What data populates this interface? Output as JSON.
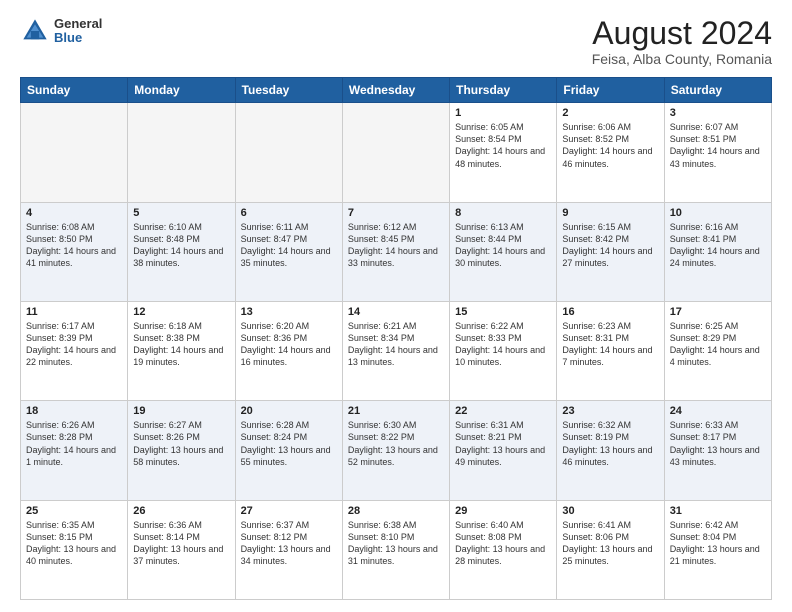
{
  "logo": {
    "general": "General",
    "blue": "Blue"
  },
  "title": "August 2024",
  "subtitle": "Feisa, Alba County, Romania",
  "weekdays": [
    "Sunday",
    "Monday",
    "Tuesday",
    "Wednesday",
    "Thursday",
    "Friday",
    "Saturday"
  ],
  "weeks": [
    [
      {
        "day": "",
        "info": ""
      },
      {
        "day": "",
        "info": ""
      },
      {
        "day": "",
        "info": ""
      },
      {
        "day": "",
        "info": ""
      },
      {
        "day": "1",
        "info": "Sunrise: 6:05 AM\nSunset: 8:54 PM\nDaylight: 14 hours and 48 minutes."
      },
      {
        "day": "2",
        "info": "Sunrise: 6:06 AM\nSunset: 8:52 PM\nDaylight: 14 hours and 46 minutes."
      },
      {
        "day": "3",
        "info": "Sunrise: 6:07 AM\nSunset: 8:51 PM\nDaylight: 14 hours and 43 minutes."
      }
    ],
    [
      {
        "day": "4",
        "info": "Sunrise: 6:08 AM\nSunset: 8:50 PM\nDaylight: 14 hours and 41 minutes."
      },
      {
        "day": "5",
        "info": "Sunrise: 6:10 AM\nSunset: 8:48 PM\nDaylight: 14 hours and 38 minutes."
      },
      {
        "day": "6",
        "info": "Sunrise: 6:11 AM\nSunset: 8:47 PM\nDaylight: 14 hours and 35 minutes."
      },
      {
        "day": "7",
        "info": "Sunrise: 6:12 AM\nSunset: 8:45 PM\nDaylight: 14 hours and 33 minutes."
      },
      {
        "day": "8",
        "info": "Sunrise: 6:13 AM\nSunset: 8:44 PM\nDaylight: 14 hours and 30 minutes."
      },
      {
        "day": "9",
        "info": "Sunrise: 6:15 AM\nSunset: 8:42 PM\nDaylight: 14 hours and 27 minutes."
      },
      {
        "day": "10",
        "info": "Sunrise: 6:16 AM\nSunset: 8:41 PM\nDaylight: 14 hours and 24 minutes."
      }
    ],
    [
      {
        "day": "11",
        "info": "Sunrise: 6:17 AM\nSunset: 8:39 PM\nDaylight: 14 hours and 22 minutes."
      },
      {
        "day": "12",
        "info": "Sunrise: 6:18 AM\nSunset: 8:38 PM\nDaylight: 14 hours and 19 minutes."
      },
      {
        "day": "13",
        "info": "Sunrise: 6:20 AM\nSunset: 8:36 PM\nDaylight: 14 hours and 16 minutes."
      },
      {
        "day": "14",
        "info": "Sunrise: 6:21 AM\nSunset: 8:34 PM\nDaylight: 14 hours and 13 minutes."
      },
      {
        "day": "15",
        "info": "Sunrise: 6:22 AM\nSunset: 8:33 PM\nDaylight: 14 hours and 10 minutes."
      },
      {
        "day": "16",
        "info": "Sunrise: 6:23 AM\nSunset: 8:31 PM\nDaylight: 14 hours and 7 minutes."
      },
      {
        "day": "17",
        "info": "Sunrise: 6:25 AM\nSunset: 8:29 PM\nDaylight: 14 hours and 4 minutes."
      }
    ],
    [
      {
        "day": "18",
        "info": "Sunrise: 6:26 AM\nSunset: 8:28 PM\nDaylight: 14 hours and 1 minute."
      },
      {
        "day": "19",
        "info": "Sunrise: 6:27 AM\nSunset: 8:26 PM\nDaylight: 13 hours and 58 minutes."
      },
      {
        "day": "20",
        "info": "Sunrise: 6:28 AM\nSunset: 8:24 PM\nDaylight: 13 hours and 55 minutes."
      },
      {
        "day": "21",
        "info": "Sunrise: 6:30 AM\nSunset: 8:22 PM\nDaylight: 13 hours and 52 minutes."
      },
      {
        "day": "22",
        "info": "Sunrise: 6:31 AM\nSunset: 8:21 PM\nDaylight: 13 hours and 49 minutes."
      },
      {
        "day": "23",
        "info": "Sunrise: 6:32 AM\nSunset: 8:19 PM\nDaylight: 13 hours and 46 minutes."
      },
      {
        "day": "24",
        "info": "Sunrise: 6:33 AM\nSunset: 8:17 PM\nDaylight: 13 hours and 43 minutes."
      }
    ],
    [
      {
        "day": "25",
        "info": "Sunrise: 6:35 AM\nSunset: 8:15 PM\nDaylight: 13 hours and 40 minutes."
      },
      {
        "day": "26",
        "info": "Sunrise: 6:36 AM\nSunset: 8:14 PM\nDaylight: 13 hours and 37 minutes."
      },
      {
        "day": "27",
        "info": "Sunrise: 6:37 AM\nSunset: 8:12 PM\nDaylight: 13 hours and 34 minutes."
      },
      {
        "day": "28",
        "info": "Sunrise: 6:38 AM\nSunset: 8:10 PM\nDaylight: 13 hours and 31 minutes."
      },
      {
        "day": "29",
        "info": "Sunrise: 6:40 AM\nSunset: 8:08 PM\nDaylight: 13 hours and 28 minutes."
      },
      {
        "day": "30",
        "info": "Sunrise: 6:41 AM\nSunset: 8:06 PM\nDaylight: 13 hours and 25 minutes."
      },
      {
        "day": "31",
        "info": "Sunrise: 6:42 AM\nSunset: 8:04 PM\nDaylight: 13 hours and 21 minutes."
      }
    ]
  ]
}
